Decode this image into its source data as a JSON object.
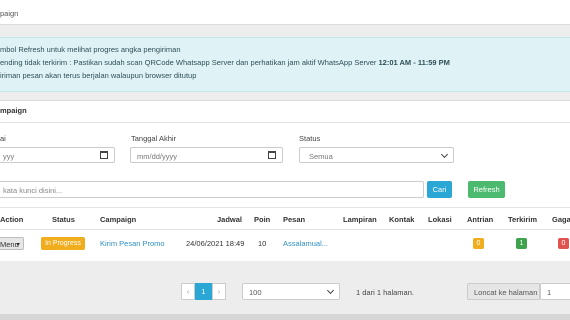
{
  "breadcrumb": {
    "text": "paign"
  },
  "info": {
    "line1": "mbol Refresh untuk melihat progres angka pengiriman",
    "line2_prefix": "ending tidak terkirim : Pastikan sudah scan QRCode Whatsapp Server dan perhatikan jam aktif WhatsApp Server ",
    "line2_bold": "12:01 AM - 11:59 PM",
    "line3": "iriman pesan akan terus berjalan walaupun browser ditutup"
  },
  "card": {
    "title": "mpaign"
  },
  "filters": {
    "start_label": "ai",
    "start_value": "yyy",
    "end_label": "Tanggal Akhir",
    "end_value": "mm/dd/yyyy",
    "status_label": "Status",
    "status_value": "Semua",
    "search_placeholder": "kata kunci disini...",
    "search_button": "Cari",
    "refresh_button": "Refresh"
  },
  "table": {
    "headers": {
      "action": "Action",
      "status": "Status",
      "campaign": "Campaign",
      "jadwal": "Jadwal",
      "poin": "Poin",
      "pesan": "Pesan",
      "lampiran": "Lampiran",
      "kontak": "Kontak",
      "lokasi": "Lokasi",
      "antrian": "Antrian",
      "terkirim": "Terkirim",
      "gagal": "Gaga"
    },
    "row": {
      "action": "Menu",
      "status": "In Progress",
      "campaign": "Kirim Pesan Promo",
      "jadwal": "24/06/2021 18:49",
      "poin": "10",
      "pesan": "Assalamual...",
      "antrian": "0",
      "terkirim": "1",
      "gagal": "0"
    }
  },
  "pagination": {
    "prev": "‹",
    "current": "1",
    "next": "›",
    "page_size": "100",
    "info": "1 dari 1 halaman.",
    "goto_label": "Loncat ke halaman",
    "goto_value": "1"
  },
  "colors": {
    "status_badge": "#f0ad1d",
    "antrian": "#f0ad1d",
    "terkirim": "#3fa34d",
    "gagal": "#e0534f",
    "search_btn": "#2ba7d6",
    "refresh_btn": "#4cba6e",
    "link": "#2c8fbf"
  }
}
